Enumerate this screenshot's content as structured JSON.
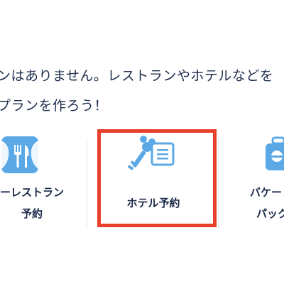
{
  "message": {
    "line1": "ンはありません。レストランやホテルなどを",
    "line2": "プランを作ろう！"
  },
  "cards": [
    {
      "id": "restaurant",
      "line1": "ーレストラン",
      "line2": "予約",
      "icon": "restaurant-icon"
    },
    {
      "id": "hotel",
      "line1": "ホテル予約",
      "line2": "",
      "icon": "key-ticket-icon"
    },
    {
      "id": "vacation",
      "line1": "バケー",
      "line2": "パック",
      "icon": "suitcase-icon"
    }
  ],
  "colors": {
    "icon_blue": "#5aa9e6",
    "highlight": "#e8402a",
    "text": "#1b2a4a"
  }
}
